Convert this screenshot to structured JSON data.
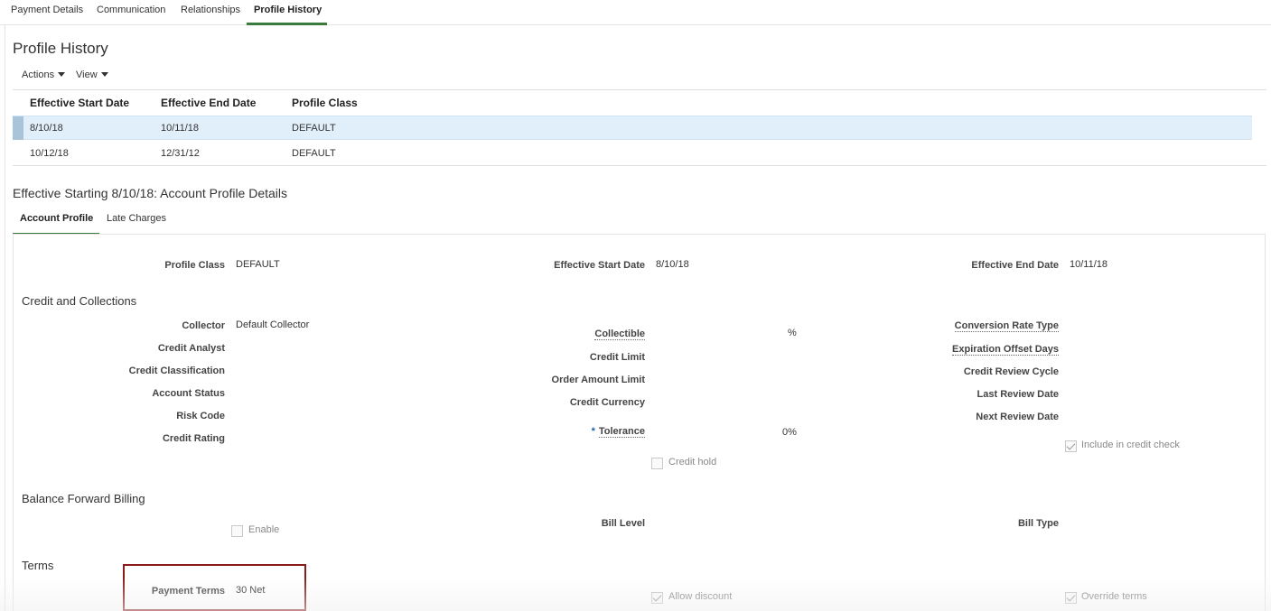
{
  "tabs": [
    {
      "label": "Payment Details"
    },
    {
      "label": "Communication"
    },
    {
      "label": "Relationships"
    },
    {
      "label": "Profile History"
    }
  ],
  "profile_history": {
    "title": "Profile History",
    "actions_label": "Actions",
    "view_label": "View",
    "columns": [
      "Effective Start Date",
      "Effective End Date",
      "Profile Class"
    ],
    "rows": [
      {
        "start": "8/10/18",
        "end": "10/11/18",
        "profile_class": "DEFAULT"
      },
      {
        "start": "10/12/18",
        "end": "12/31/12",
        "profile_class": "DEFAULT"
      }
    ]
  },
  "details": {
    "title": "Effective Starting 8/10/18: Account Profile Details",
    "subtabs": [
      {
        "label": "Account Profile"
      },
      {
        "label": "Late Charges"
      }
    ],
    "profile_class_label": "Profile Class",
    "profile_class_value": "DEFAULT",
    "eff_start_label": "Effective Start Date",
    "eff_start_value": "8/10/18",
    "eff_end_label": "Effective End Date",
    "eff_end_value": "10/11/18"
  },
  "credit": {
    "section": "Credit and Collections",
    "collector_label": "Collector",
    "collector_value": "Default Collector",
    "credit_analyst_label": "Credit Analyst",
    "credit_classification_label": "Credit Classification",
    "account_status_label": "Account Status",
    "risk_code_label": "Risk Code",
    "credit_rating_label": "Credit Rating",
    "collectible_label": "Collectible",
    "collectible_unit": "%",
    "credit_limit_label": "Credit Limit",
    "order_amount_limit_label": "Order Amount Limit",
    "credit_currency_label": "Credit Currency",
    "tolerance_required": "*",
    "tolerance_label": "Tolerance",
    "tolerance_value": "0%",
    "credit_hold_label": "Credit hold",
    "credit_hold_checked": false,
    "conversion_rate_type_label": "Conversion Rate Type",
    "expiration_offset_days_label": "Expiration Offset Days",
    "credit_review_cycle_label": "Credit Review Cycle",
    "last_review_date_label": "Last Review Date",
    "next_review_date_label": "Next Review Date",
    "include_credit_check_label": "Include in credit check",
    "include_credit_check_checked": true
  },
  "bfb": {
    "section": "Balance Forward Billing",
    "enable_label": "Enable",
    "enable_checked": false,
    "bill_level_label": "Bill Level",
    "bill_type_label": "Bill Type"
  },
  "terms": {
    "section": "Terms",
    "payment_terms_label": "Payment Terms",
    "payment_terms_value": "30 Net",
    "allow_discount_label": "Allow discount",
    "allow_discount_checked": true,
    "override_terms_label": "Override terms",
    "override_terms_checked": true
  },
  "colors": {
    "selected_row": "#e1effa",
    "tab_accent": "#3a7a3a",
    "highlight_box": "#8b1a1a",
    "required_marker": "#1f5fa8"
  }
}
